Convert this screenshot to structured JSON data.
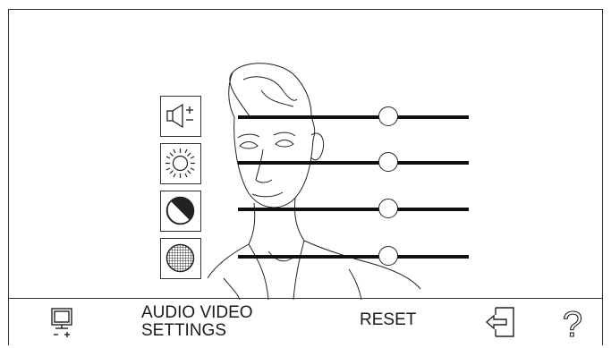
{
  "bottom_bar": {
    "settings_line1": "AUDIO VIDEO",
    "settings_line2": "SETTINGS",
    "reset_label": "RESET",
    "help_glyph": "?",
    "icons": [
      "monitor-icon",
      "exit-icon",
      "help-icon"
    ]
  },
  "controls": [
    {
      "name": "volume",
      "icon": "volume-icon",
      "value": 0.65
    },
    {
      "name": "brightness",
      "icon": "brightness-icon",
      "value": 0.65
    },
    {
      "name": "contrast",
      "icon": "contrast-icon",
      "value": 0.65
    },
    {
      "name": "color",
      "icon": "color-saturation-icon",
      "value": 0.65
    }
  ]
}
